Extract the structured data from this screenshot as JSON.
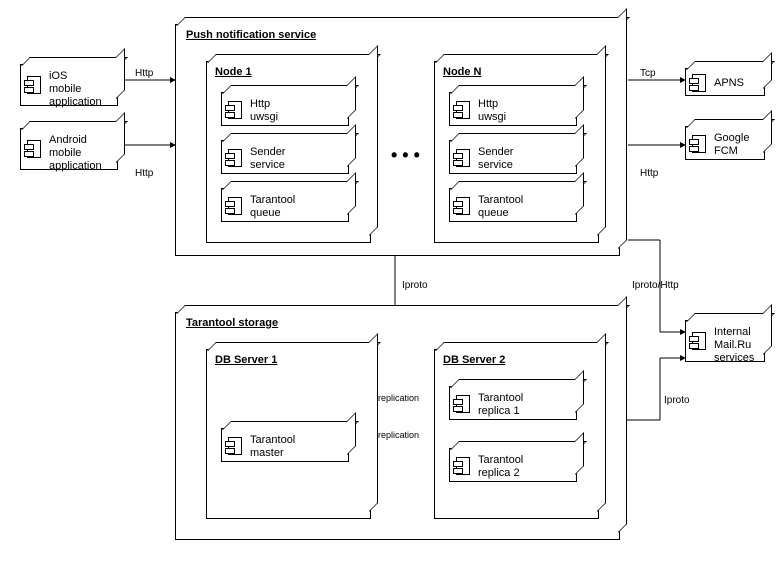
{
  "push_service": {
    "title": "Push notification service",
    "node1": {
      "title": "Node 1",
      "comp1": "Http\nuwsgi",
      "comp2": "Sender\nservice",
      "comp3": "Tarantool\nqueue"
    },
    "nodeN": {
      "title": "Node N",
      "comp1": "Http\nuwsgi",
      "comp2": "Sender\nservice",
      "comp3": "Tarantool\nqueue"
    },
    "ellipsis": "• • •"
  },
  "storage": {
    "title": "Tarantool storage",
    "db1": {
      "title": "DB Server 1",
      "comp": "Tarantool\nmaster"
    },
    "db2": {
      "title": "DB Server 2",
      "comp1": "Tarantool\nreplica 1",
      "comp2": "Tarantool\nreplica 2"
    }
  },
  "clients": {
    "ios": "iOS\nmobile\napplication",
    "android": "Android\nmobile\napplication"
  },
  "external": {
    "apns": "APNS",
    "fcm": "Google\nFCM",
    "mailru": "Internal\nMail.Ru\nservices"
  },
  "edges": {
    "http1": "Http",
    "http2": "Http",
    "tcp": "Tcp",
    "http3": "Http",
    "iproto1": "Iproto",
    "iprotohttp": "Iproto/Http",
    "iproto2": "Iproto",
    "repl1": "replication",
    "repl2": "replication"
  }
}
